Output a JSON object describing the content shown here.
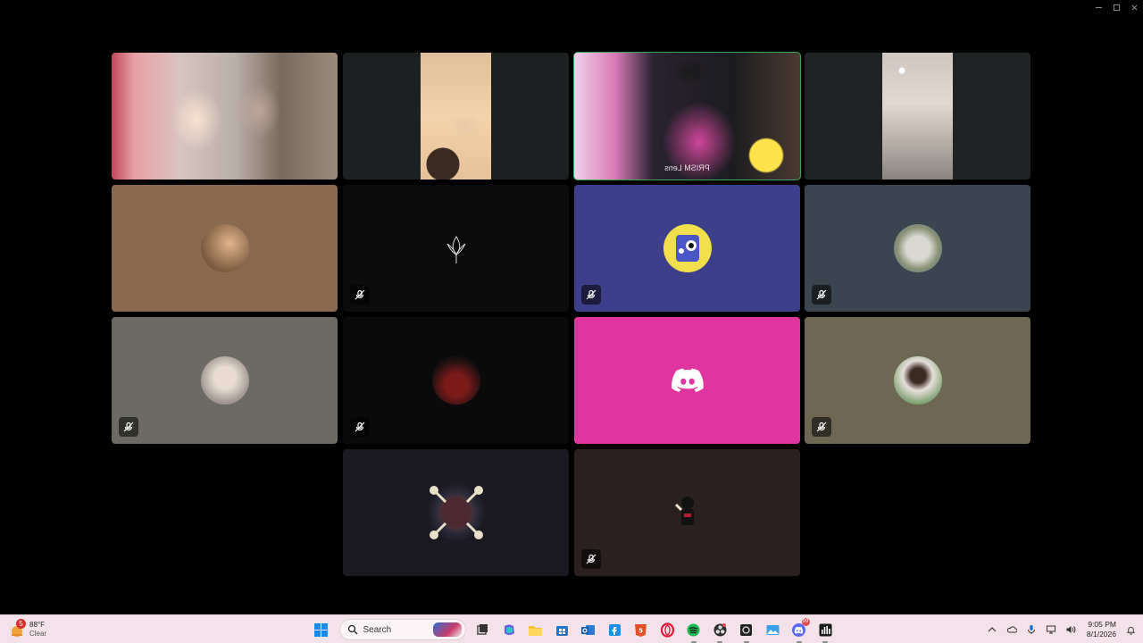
{
  "window": {
    "minimize_glyph": "—",
    "maximize_glyph": "□"
  },
  "tiles": [
    {
      "name": "participant-1-video",
      "kind": "video",
      "muted": false
    },
    {
      "name": "participant-2-video",
      "kind": "video",
      "muted": false
    },
    {
      "name": "participant-3-video",
      "kind": "video",
      "muted": false,
      "active_speaker": true,
      "overlay_text": "PRISM Lens"
    },
    {
      "name": "participant-4-video",
      "kind": "video",
      "muted": false
    },
    {
      "name": "participant-5-avatar",
      "kind": "avatar",
      "muted": false,
      "bg": "#8a6a4e"
    },
    {
      "name": "participant-6-avatar",
      "kind": "avatar",
      "muted": true,
      "bg": "#0b0b0b"
    },
    {
      "name": "participant-7-avatar",
      "kind": "avatar",
      "muted": true,
      "bg": "#3d3f8a"
    },
    {
      "name": "participant-8-avatar",
      "kind": "avatar",
      "muted": true,
      "bg": "#3a4550"
    },
    {
      "name": "participant-9-avatar",
      "kind": "avatar",
      "muted": true,
      "bg": "#6c6a63"
    },
    {
      "name": "participant-10-avatar",
      "kind": "avatar",
      "muted": true,
      "bg": "#0a0a0a"
    },
    {
      "name": "participant-11-discord-default",
      "kind": "discord",
      "muted": false,
      "bg": "#e0359f"
    },
    {
      "name": "participant-12-avatar",
      "kind": "avatar",
      "muted": true,
      "bg": "#6e6852"
    },
    {
      "name": "participant-13-avatar",
      "kind": "avatar",
      "muted": false,
      "bg": "#1b1a22"
    },
    {
      "name": "participant-14-avatar",
      "kind": "avatar",
      "muted": true,
      "bg": "#2a2020"
    }
  ],
  "taskbar": {
    "weather": {
      "badge": "5",
      "temp": "88°F",
      "condition": "Clear"
    },
    "search": {
      "placeholder": "Search"
    },
    "apps": [
      {
        "name": "file-explorer-icon",
        "running": false
      },
      {
        "name": "copilot-icon",
        "running": false
      },
      {
        "name": "folder-icon",
        "running": false
      },
      {
        "name": "store-icon",
        "running": false
      },
      {
        "name": "outlook-icon",
        "running": false
      },
      {
        "name": "facebook-icon",
        "running": false
      },
      {
        "name": "html5-icon",
        "running": false
      },
      {
        "name": "opera-icon",
        "running": false
      },
      {
        "name": "spotify-icon",
        "running": true
      },
      {
        "name": "obs-icon",
        "running": true
      },
      {
        "name": "camera-app-icon",
        "running": true
      },
      {
        "name": "photos-icon",
        "running": false
      },
      {
        "name": "discord-icon",
        "running": true,
        "badge": "99"
      },
      {
        "name": "audio-meter-icon",
        "running": true
      }
    ],
    "clock": {
      "time": "9:05 PM",
      "date": "8/1/2026"
    }
  },
  "colors": {
    "active_outline": "#3ba55d",
    "taskbar_bg": "#f3e2ea",
    "discord_blurple": "#5865f2"
  }
}
